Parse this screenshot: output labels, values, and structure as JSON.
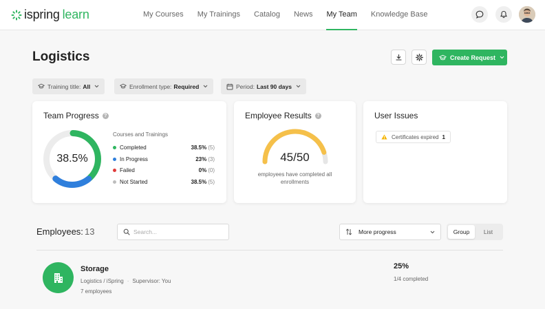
{
  "brand": {
    "name_part1": "ispring",
    "name_part2": "learn",
    "color": "#2fb560"
  },
  "nav": {
    "items": [
      {
        "label": "My Courses"
      },
      {
        "label": "My Trainings"
      },
      {
        "label": "Catalog"
      },
      {
        "label": "News"
      },
      {
        "label": "My Team",
        "active": true
      },
      {
        "label": "Knowledge Base"
      }
    ],
    "icons": [
      "chat-icon",
      "bell-icon",
      "avatar"
    ]
  },
  "page": {
    "title": "Logistics",
    "create_request_label": "Create Request"
  },
  "filters": [
    {
      "label": "Training title:",
      "value": "All",
      "icon": "graduation-cap-icon"
    },
    {
      "label": "Enrollment type:",
      "value": "Required",
      "icon": "graduation-cap-icon"
    },
    {
      "label": "Period:",
      "value": "Last 90 days",
      "icon": "calendar-icon"
    }
  ],
  "team_progress": {
    "title": "Team Progress",
    "center_value": "38.5%",
    "legend_title": "Courses and Trainings",
    "rows": [
      {
        "label": "Completed",
        "pct": "38.5%",
        "count": "(5)",
        "color": "#2fb560",
        "fraction": 0.385
      },
      {
        "label": "In Progress",
        "pct": "23%",
        "count": "(3)",
        "color": "#2f7fdc",
        "fraction": 0.23
      },
      {
        "label": "Failed",
        "pct": "0%",
        "count": "(0)",
        "color": "#e03b3b",
        "fraction": 0
      },
      {
        "label": "Not Started",
        "pct": "38.5%",
        "count": "(5)",
        "color": "#bdbdbd",
        "fraction": 0.385
      }
    ]
  },
  "employee_results": {
    "title": "Employee Results",
    "value": "45/50",
    "fraction": 0.9,
    "caption_line1": "employees have completed all",
    "caption_line2": "enrollments",
    "gauge_color": "#f5c04a",
    "track_color": "#e6e6e6"
  },
  "user_issues": {
    "title": "User Issues",
    "badge_label": "Certificates expired",
    "badge_count": "1",
    "warning_color": "#f5b400"
  },
  "employees": {
    "title": "Employees:",
    "count": "13",
    "search_placeholder": "Search...",
    "sort_label": "More progress",
    "view_group": "Group",
    "view_list": "List"
  },
  "group": {
    "name": "Storage",
    "path": "Logistics / iSpring",
    "supervisor": "Supervisor: You",
    "employees": "7 employees",
    "pct": "25%",
    "completed": "1/4 completed"
  }
}
